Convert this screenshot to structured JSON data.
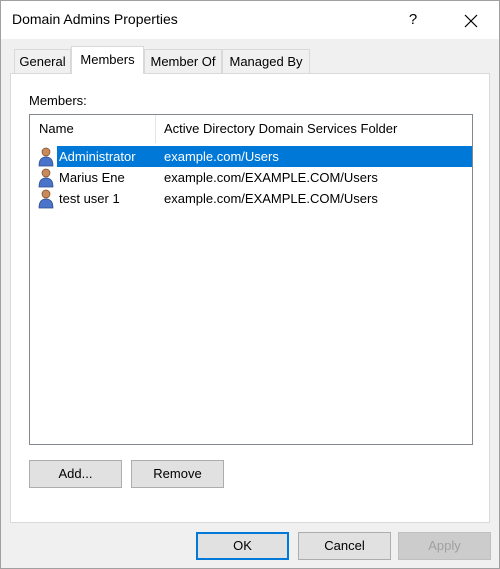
{
  "window": {
    "title": "Domain Admins Properties",
    "help_glyph": "?"
  },
  "tabs": [
    {
      "label": "General",
      "active": false
    },
    {
      "label": "Members",
      "active": true
    },
    {
      "label": "Member Of",
      "active": false
    },
    {
      "label": "Managed By",
      "active": false
    }
  ],
  "members": {
    "label": "Members:",
    "columns": [
      "Name",
      "Active Directory Domain Services Folder"
    ],
    "rows": [
      {
        "name": "Administrator",
        "folder": "example.com/Users",
        "selected": true,
        "icon": "user-icon"
      },
      {
        "name": "Marius Ene",
        "folder": "example.com/EXAMPLE.COM/Users",
        "selected": false,
        "icon": "user-icon"
      },
      {
        "name": "test user 1",
        "folder": "example.com/EXAMPLE.COM/Users",
        "selected": false,
        "icon": "user-icon"
      }
    ]
  },
  "list_buttons": {
    "add": "Add...",
    "remove": "Remove"
  },
  "dialog_buttons": {
    "ok": "OK",
    "cancel": "Cancel",
    "apply": "Apply"
  },
  "colors": {
    "selection": "#0078d7",
    "panel": "#ffffff",
    "chrome": "#f0f0f0"
  }
}
